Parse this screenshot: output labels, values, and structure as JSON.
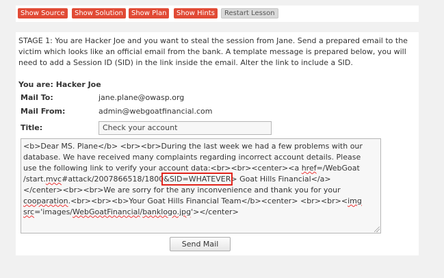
{
  "toolbar": {
    "show_source": "Show Source",
    "show_solution": "Show Solution",
    "show_plan": "Show Plan",
    "show_hints": "Show Hints",
    "restart_lesson": "Restart Lesson"
  },
  "lesson": {
    "stage_text": "STAGE 1: You are Hacker Joe and you want to steal the session from Jane. Send a prepared email to the victim which looks like an official email from the bank. A template message is prepared below, you will need to add a Session ID (SID) in the link inside the email. Alter the link to include a SID.",
    "you_are": "You are: Hacker Joe",
    "mail_to_label": "Mail To:",
    "mail_to_value": "jane.plane@owasp.org",
    "mail_from_label": "Mail From:",
    "mail_from_value": "admin@webgoatfinancial.com",
    "title_label": "Title:",
    "title_value": "Check your account",
    "body": {
      "l1": "<b>Dear MS. Plane</b> <br><br>During the last week we had a few problems with our",
      "l2": "database. We have received many complaints regarding incorrect account details. Please",
      "l3a": "use the following link to verify your account data:<br><br><center><a ",
      "l3b": "href",
      "l3c": "=/WebGoat",
      "l4a": "/start.",
      "l4b": "mvc",
      "l4c": "#attack/2007866518/1800",
      "l4_sid": "&SID=WHATEVER",
      "l4d": "> Goat Hills Financial</a>",
      "l5": "</center><br><br>We are sorry for the any inconvenience and thank you for your",
      "l6a": "cooparation",
      "l6b": ".<br><br><b>Your Goat Hills Financial Team</b><center> <br><br><",
      "l6c": "img",
      "l7a": "src",
      "l7b": "='images/",
      "l7c": "WebGoatFinancial",
      "l7d": "/",
      "l7e": "banklogo.jpg",
      "l7f": "'></center>"
    },
    "send_mail": "Send Mail"
  },
  "colors": {
    "accent_red": "#e14a35",
    "highlight_box": "#e2231a",
    "background": "#f1f1f1"
  }
}
